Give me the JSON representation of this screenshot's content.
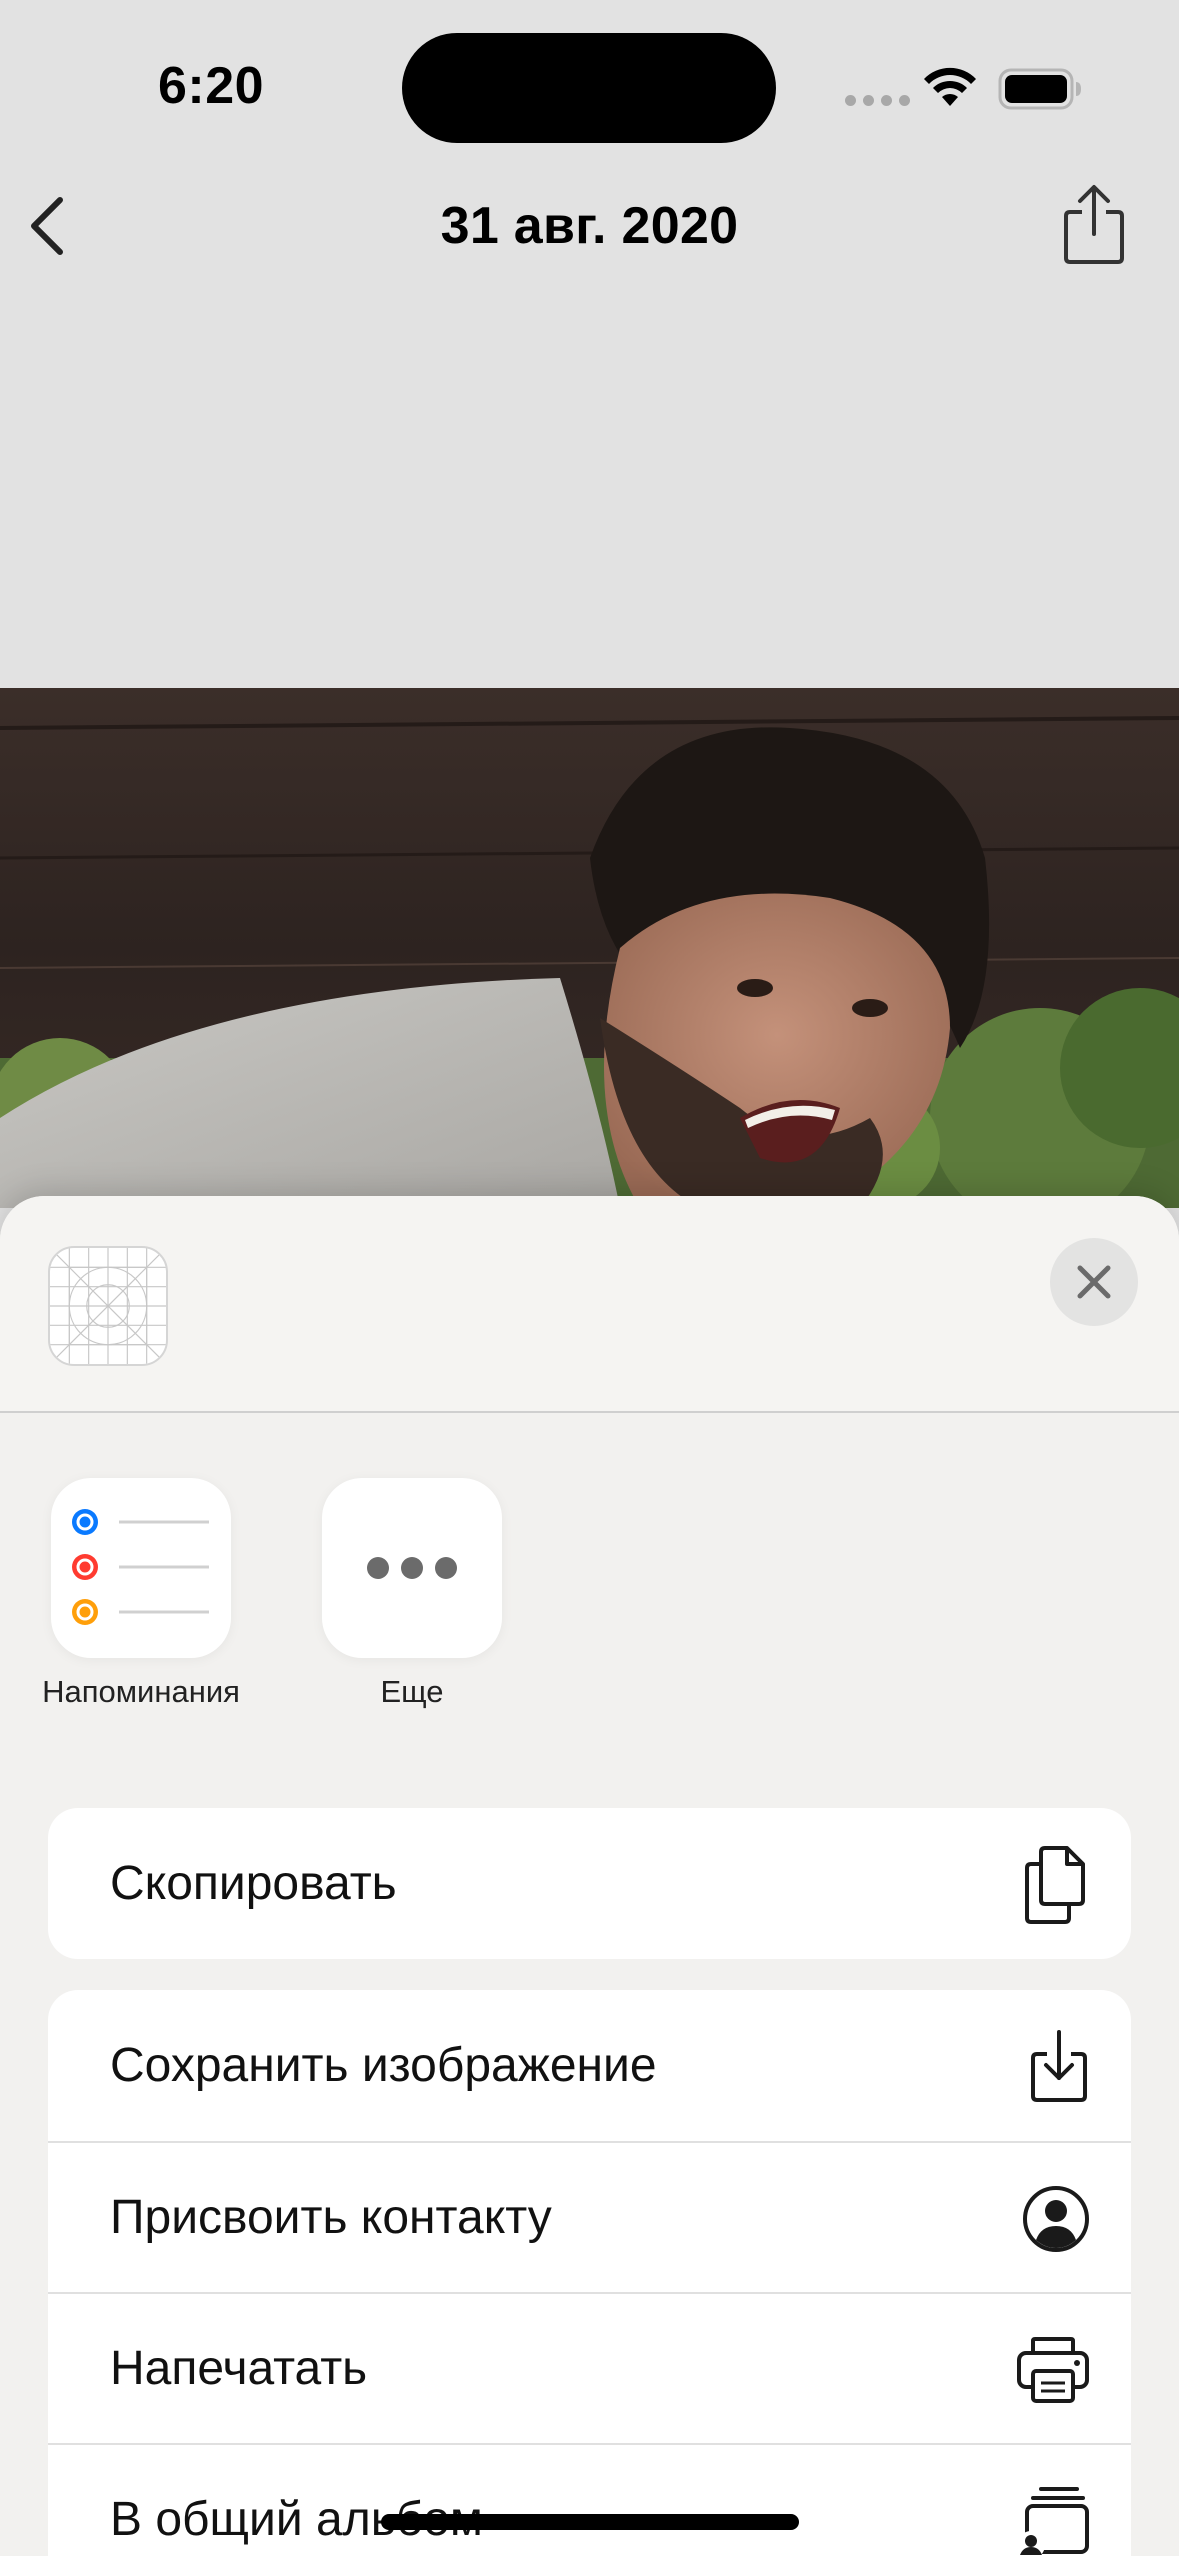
{
  "status_bar": {
    "time": "6:20"
  },
  "nav": {
    "title": "31 авг. 2020"
  },
  "share_sheet": {
    "apps": [
      {
        "label": "Напоминания",
        "icon": "reminders-icon"
      },
      {
        "label": "Еще",
        "icon": "more-icon"
      }
    ],
    "actions_group1": [
      {
        "label": "Скопировать",
        "icon": "copy-icon"
      }
    ],
    "actions_group2": [
      {
        "label": "Сохранить изображение",
        "icon": "save-image-icon"
      },
      {
        "label": "Присвоить контакту",
        "icon": "person-circle-icon"
      },
      {
        "label": "Напечатать",
        "icon": "printer-icon"
      },
      {
        "label": "В общий альбом",
        "icon": "shared-album-icon"
      }
    ]
  },
  "colors": {
    "background": "#e2e2e2",
    "sheet": "#f2f1ef",
    "reminder_blue": "#0a7aff",
    "reminder_red": "#ff3b30",
    "reminder_orange": "#ff9f0a"
  }
}
